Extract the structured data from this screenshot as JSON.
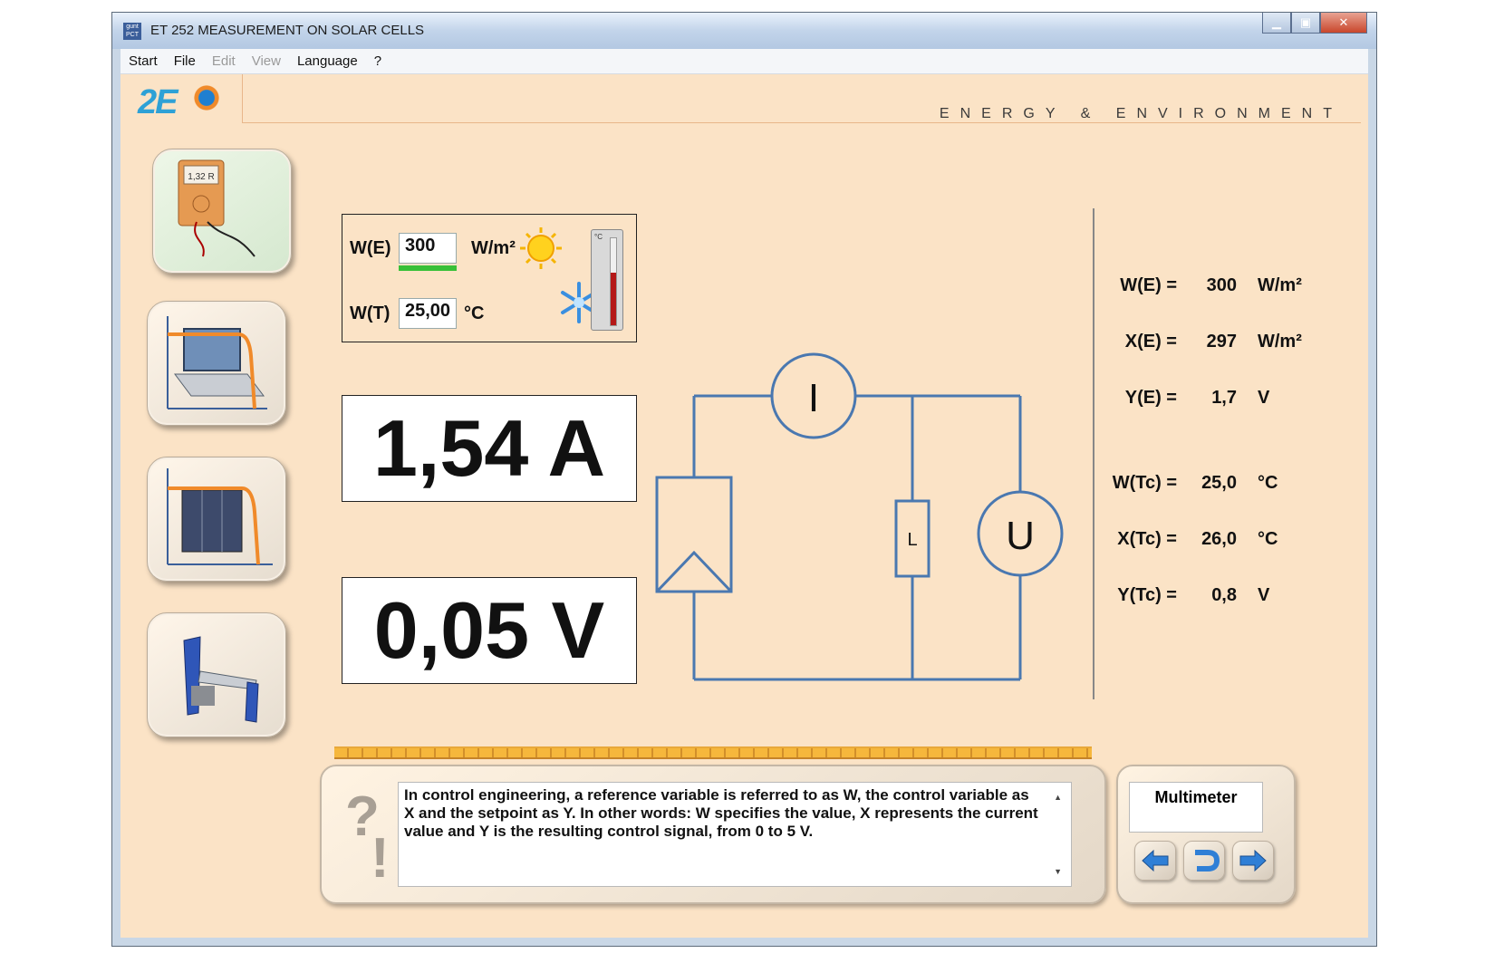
{
  "window": {
    "title": "ET 252 MEASUREMENT ON SOLAR CELLS",
    "app_icon_text": "gunt PCTut"
  },
  "menu": [
    "Start",
    "File",
    "Edit",
    "View",
    "Language",
    "?"
  ],
  "menu_disabled": [
    "Edit",
    "View"
  ],
  "header": {
    "logo_text": "2E",
    "tagline": "ENERGY & ENVIRONMENT"
  },
  "sidebar": {
    "items": [
      {
        "name": "multimeter",
        "display_text": "1,32 R",
        "active": true
      },
      {
        "name": "laptop-curve"
      },
      {
        "name": "solar-cell-curve"
      },
      {
        "name": "test-stand"
      }
    ]
  },
  "setpoints": {
    "we_label": "W(E)",
    "we_value": "300",
    "we_unit": "W/m²",
    "we_level": 1.0,
    "wt_label": "W(T)",
    "wt_value": "25,00",
    "wt_unit": "°C",
    "thermo_unit": "°C",
    "thermo_level": 0.6
  },
  "readouts": {
    "current": "1,54 A",
    "voltage": "0,05 V"
  },
  "circuit": {
    "ammeter": "I",
    "voltmeter": "U",
    "load": "L"
  },
  "measurements": [
    {
      "label": "W(E) =",
      "value": "300",
      "unit": "W/m²"
    },
    {
      "label": "X(E) =",
      "value": "297",
      "unit": "W/m²"
    },
    {
      "label": "Y(E) =",
      "value": "1,7",
      "unit": "V"
    },
    {
      "label": "W(Tc) =",
      "value": "25,0",
      "unit": "°C"
    },
    {
      "label": "X(Tc) =",
      "value": "26,0",
      "unit": "°C"
    },
    {
      "label": "Y(Tc) =",
      "value": "0,8",
      "unit": "V"
    }
  ],
  "help": {
    "text": "In control engineering, a reference variable is referred to as W, the control variable as X and the setpoint as Y.  In other words: W specifies the value, X represents the current value and Y is the resulting control signal, from 0 to 5 V."
  },
  "multimeter_panel": {
    "title": "Multimeter"
  },
  "colors": {
    "background": "#fbe3c6",
    "circuit": "#4a78b0",
    "accent": "#f08a2a"
  }
}
